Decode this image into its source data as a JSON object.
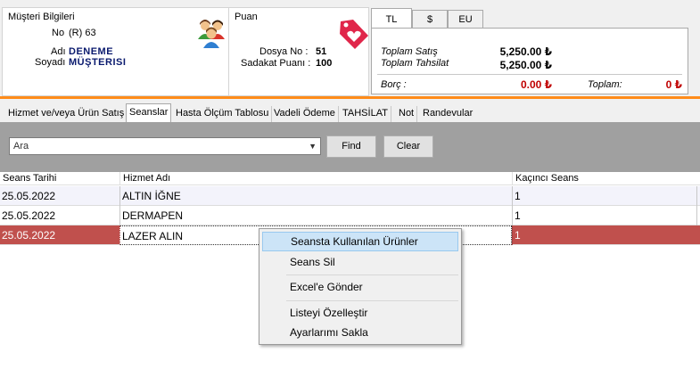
{
  "customer": {
    "section_title": "Müşteri Bilgileri",
    "no_label": "No",
    "no_value": "(R) 63",
    "first_name_label": "Adı",
    "first_name": "DENEME",
    "last_name_label": "Soyadı",
    "last_name": "MÜŞTERISI",
    "icon": "people-icon"
  },
  "points": {
    "section_title": "Puan",
    "file_no_label": "Dosya No :",
    "file_no": "51",
    "loyalty_label": "Sadakat Puanı :",
    "loyalty_points": "100",
    "icon": "heart-tag-icon"
  },
  "currency": {
    "tabs": [
      "TL",
      "$",
      "EU"
    ],
    "active_tab": "TL",
    "total_sales_label": "Toplam Satış",
    "total_sales": "5,250.00 ₺",
    "total_collected_label": "Toplam Tahsilat",
    "total_collected": "5,250.00 ₺",
    "debt_label": "Borç :",
    "debt": "0.00 ₺",
    "total_label": "Toplam:",
    "total": "0 ₺"
  },
  "main_tabs": [
    {
      "label": "Hizmet ve/veya Ürün Satış"
    },
    {
      "label": "Seanslar"
    },
    {
      "label": "Hasta Ölçüm Tablosu"
    },
    {
      "label": "Vadeli Ödeme"
    },
    {
      "label": "TAHSİLAT"
    },
    {
      "label": "Not"
    },
    {
      "label": "Randevular"
    }
  ],
  "active_main_tab": "Seanslar",
  "search": {
    "value": "Ara",
    "find_label": "Find",
    "clear_label": "Clear"
  },
  "grid": {
    "columns": [
      "Seans Tarihi",
      "Hizmet Adı",
      "Kaçıncı Seans"
    ],
    "rows": [
      {
        "date": "25.05.2022",
        "service": "ALTIN İĞNE",
        "session": "1"
      },
      {
        "date": "25.05.2022",
        "service": "DERMAPEN",
        "session": "1"
      },
      {
        "date": "25.05.2022",
        "service": "LAZER ALIN",
        "session": "1"
      }
    ],
    "selected_row": 3
  },
  "context_menu": {
    "items": [
      "Seansta Kullanılan Ürünler",
      "Seans Sil",
      "Excel'e Gönder",
      "Listeyi Özelleştir",
      "Ayarlarımı Sakla"
    ],
    "highlighted_item": "Seansta Kullanılan Ürünler"
  },
  "colors": {
    "accent_orange": "#ff8c1a",
    "selected_row": "#c0504d",
    "debt_red": "#c00000",
    "name_navy": "#0a1a6e"
  }
}
